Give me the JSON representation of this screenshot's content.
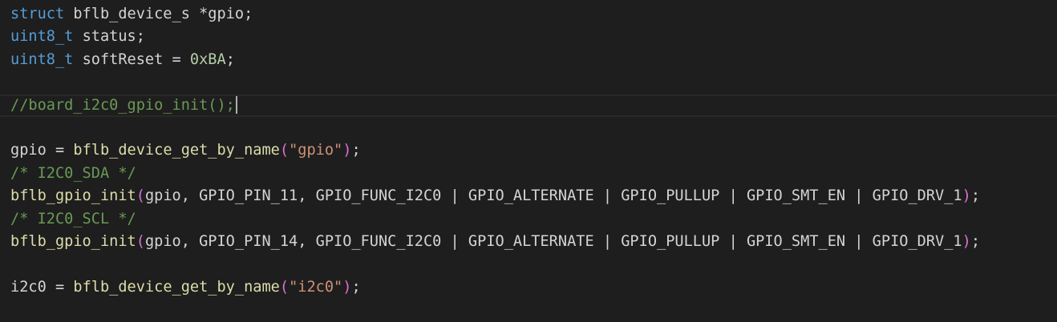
{
  "colors": {
    "background": "#1e1e1e",
    "current_line_border": "#282828",
    "cursor": "#aeafad"
  },
  "code_lines": [
    [
      {
        "text": "struct",
        "color": "#569cd6"
      },
      {
        "text": " bflb_device_s ",
        "color": "#d4d4d4"
      },
      {
        "text": "*",
        "color": "#d4d4d4"
      },
      {
        "text": "gpio;",
        "color": "#d4d4d4"
      }
    ],
    [
      {
        "text": "uint8_t",
        "color": "#569cd6"
      },
      {
        "text": " status;",
        "color": "#d4d4d4"
      }
    ],
    [
      {
        "text": "uint8_t",
        "color": "#569cd6"
      },
      {
        "text": " softReset = ",
        "color": "#d4d4d4"
      },
      {
        "text": "0xBA",
        "color": "#b5cea8"
      },
      {
        "text": ";",
        "color": "#d4d4d4"
      }
    ],
    [],
    [
      {
        "text": "//board_i2c0_gpio_init();",
        "color": "#6a9955"
      }
    ],
    [],
    [
      {
        "text": "gpio = ",
        "color": "#d4d4d4"
      },
      {
        "text": "bflb_device_get_by_name",
        "color": "#dcdcaa"
      },
      {
        "text": "(",
        "color": "#da70d6"
      },
      {
        "text": "\"gpio\"",
        "color": "#ce9178"
      },
      {
        "text": ")",
        "color": "#da70d6"
      },
      {
        "text": ";",
        "color": "#d4d4d4"
      }
    ],
    [
      {
        "text": "/* I2C0_SDA */",
        "color": "#6a9955"
      }
    ],
    [
      {
        "text": "bflb_gpio_init",
        "color": "#dcdcaa"
      },
      {
        "text": "(",
        "color": "#da70d6"
      },
      {
        "text": "gpio, GPIO_PIN_11, GPIO_FUNC_I2C0 | GPIO_ALTERNATE | GPIO_PULLUP | GPIO_SMT_EN | GPIO_DRV_1",
        "color": "#d4d4d4"
      },
      {
        "text": ")",
        "color": "#da70d6"
      },
      {
        "text": ";",
        "color": "#d4d4d4"
      }
    ],
    [
      {
        "text": "/* I2C0_SCL */",
        "color": "#6a9955"
      }
    ],
    [
      {
        "text": "bflb_gpio_init",
        "color": "#dcdcaa"
      },
      {
        "text": "(",
        "color": "#da70d6"
      },
      {
        "text": "gpio, GPIO_PIN_14, GPIO_FUNC_I2C0 | GPIO_ALTERNATE | GPIO_PULLUP | GPIO_SMT_EN | GPIO_DRV_1",
        "color": "#d4d4d4"
      },
      {
        "text": ")",
        "color": "#da70d6"
      },
      {
        "text": ";",
        "color": "#d4d4d4"
      }
    ],
    [],
    [
      {
        "text": "i2c0 = ",
        "color": "#d4d4d4"
      },
      {
        "text": "bflb_device_get_by_name",
        "color": "#dcdcaa"
      },
      {
        "text": "(",
        "color": "#da70d6"
      },
      {
        "text": "\"i2c0\"",
        "color": "#ce9178"
      },
      {
        "text": ")",
        "color": "#da70d6"
      },
      {
        "text": ";",
        "color": "#d4d4d4"
      }
    ]
  ],
  "cursor_line_index": 4
}
